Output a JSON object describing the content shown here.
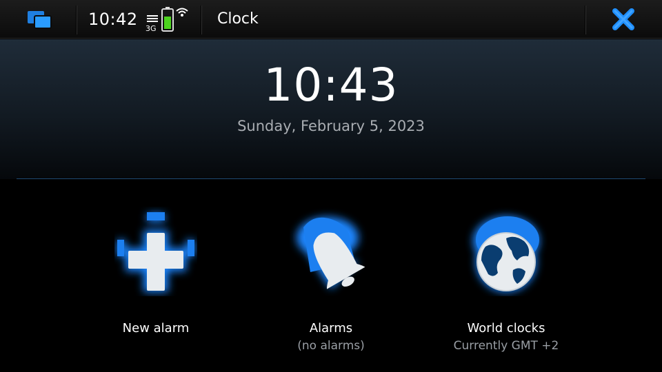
{
  "statusbar": {
    "time": "10:42",
    "network": "3G",
    "battery_color": "#4cd21e"
  },
  "app": {
    "title": "Clock"
  },
  "clock": {
    "time": "10:43",
    "date": "Sunday, February 5, 2023"
  },
  "actions": [
    {
      "label": "New alarm",
      "sublabel": "",
      "icon": "plus-icon"
    },
    {
      "label": "Alarms",
      "sublabel": "(no alarms)",
      "icon": "bell-icon"
    },
    {
      "label": "World clocks",
      "sublabel": "Currently GMT +2",
      "icon": "globe-icon"
    }
  ],
  "colors": {
    "accent": "#1a86ff",
    "close": "#1f8fff"
  }
}
